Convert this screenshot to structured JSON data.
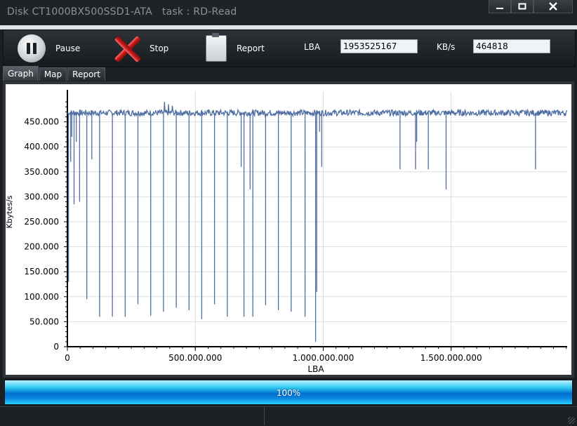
{
  "window": {
    "title": "Disk CT1000BX500SSD1-ATA   task : RD-Read",
    "minimize_icon": "minimize-icon",
    "maximize_icon": "maximize-icon",
    "close_icon": "close-icon"
  },
  "toolbar": {
    "pause_label": "Pause",
    "stop_label": "Stop",
    "report_label": "Report",
    "lba_label": "LBA",
    "lba_value": "1953525167",
    "kbs_label": "KB/s",
    "kbs_value": "464818"
  },
  "tabs": [
    {
      "label": "Graph",
      "active": true
    },
    {
      "label": "Map",
      "active": false
    },
    {
      "label": "Report",
      "active": false
    }
  ],
  "chart_data": {
    "type": "line",
    "xlabel": "LBA",
    "ylabel": "Kbytes/s",
    "xlim": [
      0,
      1953525167
    ],
    "ylim": [
      0,
      500000
    ],
    "x_ticks": [
      {
        "value": 0,
        "label": "0"
      },
      {
        "value": 500000000,
        "label": "500.000.000"
      },
      {
        "value": 1000000000,
        "label": "1.000.000.000"
      },
      {
        "value": 1500000000,
        "label": "1.500.000.000"
      }
    ],
    "y_ticks": [
      {
        "value": 0,
        "label": "0"
      },
      {
        "value": 50000,
        "label": "50.000"
      },
      {
        "value": 100000,
        "label": "100.000"
      },
      {
        "value": 150000,
        "label": "150.000"
      },
      {
        "value": 200000,
        "label": "200.000"
      },
      {
        "value": 250000,
        "label": "250.000"
      },
      {
        "value": 300000,
        "label": "300.000"
      },
      {
        "value": 350000,
        "label": "350.000"
      },
      {
        "value": 400000,
        "label": "400.000"
      },
      {
        "value": 450000,
        "label": "450.000"
      }
    ],
    "grid": true,
    "line_color": "#4f6fa3",
    "baseline": 468000,
    "dips": [
      [
        5000000,
        130000
      ],
      [
        12000000,
        370000
      ],
      [
        18000000,
        420000
      ],
      [
        27000000,
        285000
      ],
      [
        34000000,
        410000
      ],
      [
        48000000,
        290000
      ],
      [
        75000000,
        95000
      ],
      [
        95000000,
        375000
      ],
      [
        125000000,
        60000
      ],
      [
        175000000,
        60000
      ],
      [
        225000000,
        60000
      ],
      [
        275000000,
        85000
      ],
      [
        325000000,
        62000
      ],
      [
        375000000,
        70000
      ],
      [
        425000000,
        78000
      ],
      [
        475000000,
        73000
      ],
      [
        525000000,
        55000
      ],
      [
        575000000,
        85000
      ],
      [
        625000000,
        60000
      ],
      [
        680000000,
        360000
      ],
      [
        690000000,
        60000
      ],
      [
        715000000,
        315000
      ],
      [
        725000000,
        60000
      ],
      [
        775000000,
        83000
      ],
      [
        825000000,
        73000
      ],
      [
        875000000,
        70000
      ],
      [
        930000000,
        60000
      ],
      [
        970000000,
        10000
      ],
      [
        975000000,
        110000
      ],
      [
        985000000,
        430000
      ],
      [
        995000000,
        360000
      ],
      [
        1300000000,
        355000
      ],
      [
        1360000000,
        355000
      ],
      [
        1365000000,
        410000
      ],
      [
        1410000000,
        355000
      ],
      [
        1480000000,
        315000
      ],
      [
        1830000000,
        355000
      ]
    ],
    "bumps": [
      [
        380000000,
        490000
      ],
      [
        395000000,
        485000
      ],
      [
        410000000,
        482000
      ]
    ]
  },
  "progress": {
    "value": 1.0,
    "label": "100%"
  }
}
